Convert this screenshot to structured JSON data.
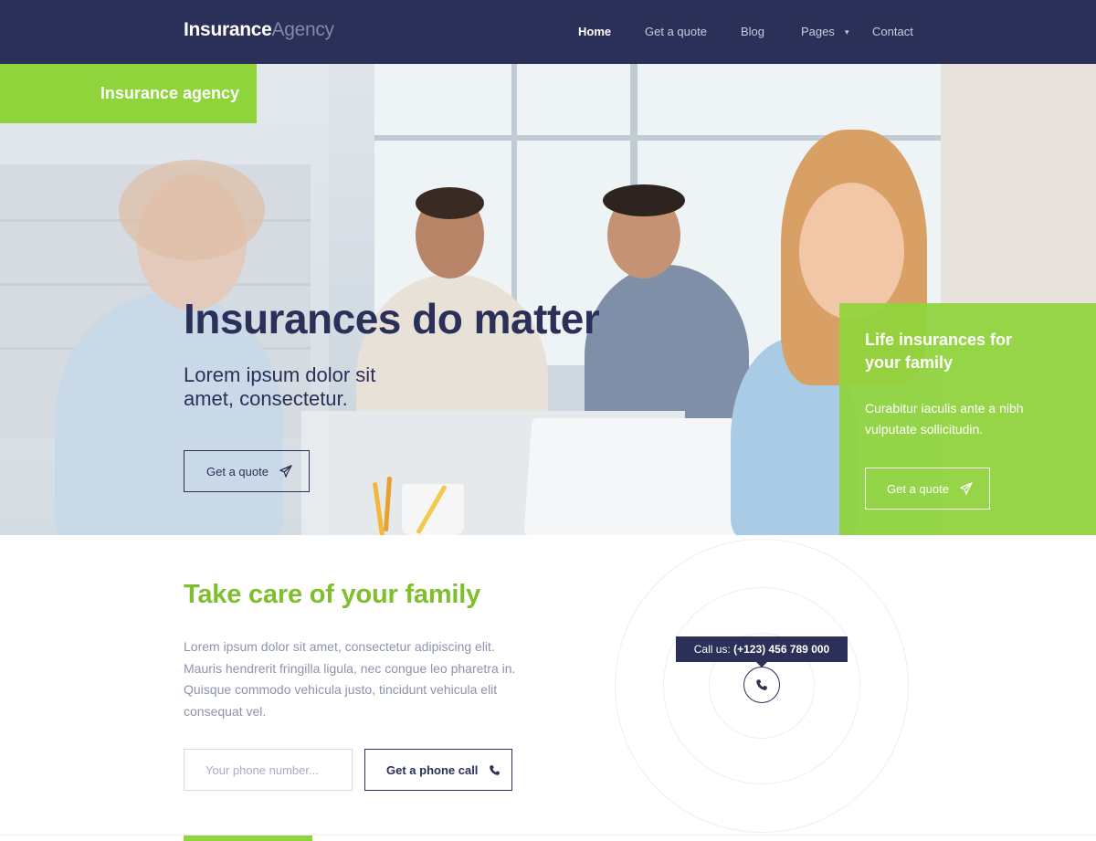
{
  "nav": {
    "brand_bold": "Insurance",
    "brand_light": "Agency",
    "items": [
      {
        "label": "Home",
        "active": true
      },
      {
        "label": "Get a quote",
        "active": false
      },
      {
        "label": "Blog",
        "active": false
      },
      {
        "label": "Pages",
        "active": false
      },
      {
        "label": "Contact",
        "active": false
      }
    ]
  },
  "hero": {
    "tag": "Insurance agency",
    "title": "Insurances do matter",
    "subtitle": "Lorem ipsum dolor sit amet, consectetur.",
    "button_label": "Get a quote",
    "button_icon": "paper-plane-icon"
  },
  "side_card": {
    "title": "Life insurances for your family",
    "text": "Curabitur iaculis ante a nibh vulputate sollicitudin.",
    "button_label": "Get a quote",
    "button_icon": "paper-plane-icon"
  },
  "care": {
    "title": "Take care of your family",
    "text": "Lorem ipsum dolor sit amet, consectetur adipiscing elit. Mauris hendrerit fringilla ligula, nec congue leo pharetra in. Quisque commodo vehicula justo, tincidunt vehicula elit consequat vel.",
    "phone_placeholder": "Your phone number...",
    "call_button_label": "Get a phone call",
    "call_button_icon": "phone-icon"
  },
  "callout": {
    "prefix": "Call us:",
    "number": "(+123) 456 789 000",
    "icon": "phone-icon"
  },
  "colors": {
    "navy": "#2b3058",
    "green": "#8fd43b",
    "green_text": "#7fbf2e",
    "muted": "#8d93ad"
  }
}
